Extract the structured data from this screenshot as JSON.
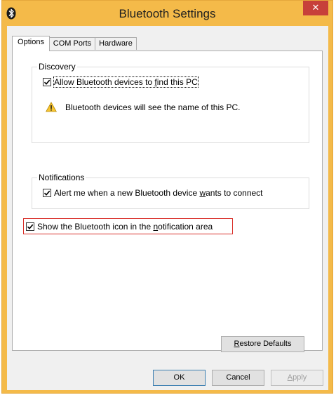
{
  "window": {
    "title": "Bluetooth Settings",
    "close_glyph": "✕",
    "title_icon": "bluetooth-icon",
    "accent_color": "#f4ba49",
    "close_color": "#c7403a"
  },
  "tabs": [
    {
      "label": "Options",
      "active": true
    },
    {
      "label": "COM Ports",
      "active": false
    },
    {
      "label": "Hardware",
      "active": false
    }
  ],
  "discovery": {
    "title": "Discovery",
    "allow_checkbox": {
      "label_before": "Allow Bluetooth devices to ",
      "mnemonic": "f",
      "label_after": "ind this PC",
      "checked": true
    },
    "warning_text": "Bluetooth devices will see the name of this PC.",
    "warning_icon": "warning-icon"
  },
  "notifications": {
    "title": "Notifications",
    "alert_checkbox": {
      "label_before": "Alert me when a new Bluetooth device ",
      "mnemonic": "w",
      "label_after": "ants to connect",
      "checked": true
    }
  },
  "show_icon_checkbox": {
    "label_before": "Show the Bluetooth icon in the ",
    "mnemonic": "n",
    "label_after": "otification area",
    "checked": true,
    "highlight_color": "#d9302a"
  },
  "buttons": {
    "restore_mnemonic": "R",
    "restore_rest": "estore Defaults",
    "ok": "OK",
    "cancel": "Cancel",
    "apply_mnemonic": "A",
    "apply_rest": "pply"
  }
}
